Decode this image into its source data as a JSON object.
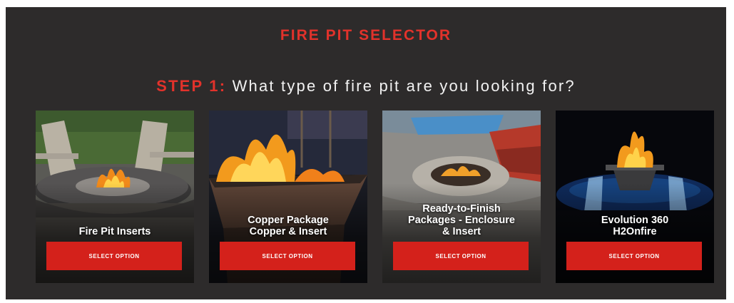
{
  "header": {
    "title": "FIRE PIT SELECTOR"
  },
  "step": {
    "label": "STEP 1:",
    "question": "What type of fire pit are you looking for?"
  },
  "cards": [
    {
      "title": "Fire Pit Inserts",
      "button": "SELECT OPTION",
      "image": "fire-pit-insert-photo"
    },
    {
      "title": "Copper Package\nCopper & Insert",
      "button": "SELECT OPTION",
      "image": "copper-fire-bowl-photo"
    },
    {
      "title": "Ready-to-Finish\nPackages - Enclosure\n& Insert",
      "button": "SELECT OPTION",
      "image": "stone-enclosure-fire-pit-photo"
    },
    {
      "title": "Evolution 360\nH2Onfire",
      "button": "SELECT OPTION",
      "image": "water-fire-bowl-photo"
    }
  ],
  "colors": {
    "accent": "#e2322b",
    "button": "#d4211b",
    "panel": "#2d2b2b"
  }
}
